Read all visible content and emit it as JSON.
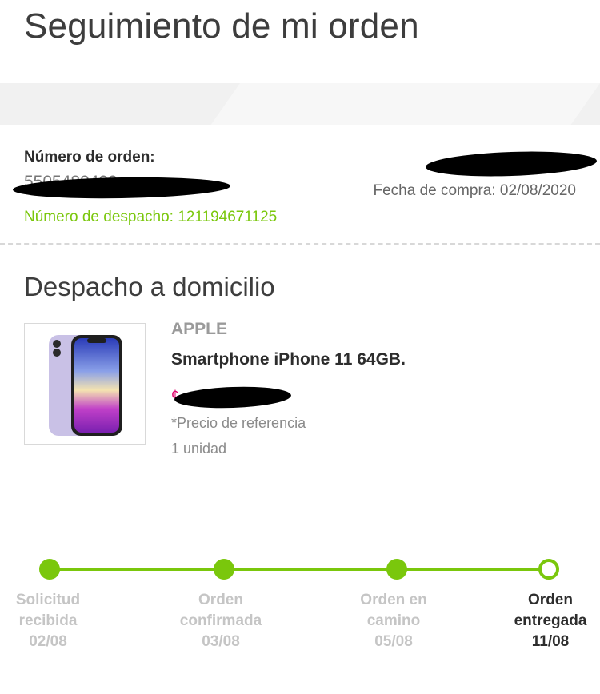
{
  "page": {
    "title": "Seguimiento de mi orden"
  },
  "order": {
    "number_label": "Número de orden:",
    "number_value": "5505480400",
    "dispatch_text": "Número de despacho: 121194671125",
    "purchase_date_text": "Fecha de compra: 02/08/2020"
  },
  "delivery": {
    "title": "Despacho a domicilio",
    "product": {
      "brand": "APPLE",
      "name": "Smartphone iPhone 11 64GB.",
      "price_symbol": "¢",
      "price_note": "*Precio de referencia",
      "quantity": "1 unidad"
    }
  },
  "tracker": {
    "steps": [
      {
        "line1": "Solicitud",
        "line2": "recibida",
        "date": "02/08",
        "state": "done"
      },
      {
        "line1": "Orden",
        "line2": "confirmada",
        "date": "03/08",
        "state": "done"
      },
      {
        "line1": "Orden en",
        "line2": "camino",
        "date": "05/08",
        "state": "done"
      },
      {
        "line1": "Orden",
        "line2": "entregada",
        "date": "11/08",
        "state": "current"
      }
    ]
  },
  "colors": {
    "accent_green": "#7ac70c",
    "price_pink": "#e0006a",
    "redaction": "#000000"
  }
}
